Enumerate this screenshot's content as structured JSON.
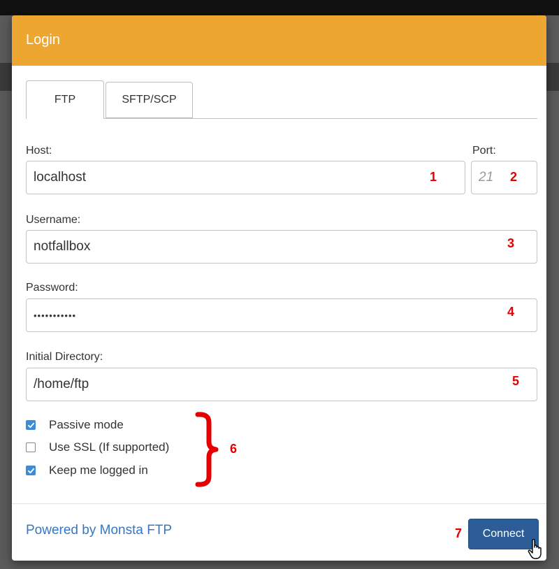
{
  "modal": {
    "title": "Login",
    "header_color": "#eda630"
  },
  "tabs": [
    {
      "label": "FTP",
      "active": true
    },
    {
      "label": "SFTP/SCP",
      "active": false
    }
  ],
  "fields": {
    "host": {
      "label": "Host:",
      "value": "localhost"
    },
    "port": {
      "label": "Port:",
      "value": "",
      "placeholder": "21"
    },
    "username": {
      "label": "Username:",
      "value": "notfallbox"
    },
    "password": {
      "label": "Password:",
      "value": "•••••••••••"
    },
    "initial_directory": {
      "label": "Initial Directory:",
      "value": "/home/ftp"
    }
  },
  "options": [
    {
      "label": "Passive mode",
      "checked": true
    },
    {
      "label": "Use SSL (If supported)",
      "checked": false
    },
    {
      "label": "Keep me logged in",
      "checked": true
    }
  ],
  "footer": {
    "powered_by": "Powered by Monsta FTP",
    "connect_label": "Connect"
  },
  "annotations": {
    "host": "1",
    "port": "2",
    "username": "3",
    "password": "4",
    "directory": "5",
    "options": "6",
    "connect": "7",
    "color": "#e40000"
  },
  "icons": {
    "checkbox_checked": "checkmark-icon",
    "brace": "curly-brace-icon",
    "pointer": "hand-pointer-icon"
  }
}
